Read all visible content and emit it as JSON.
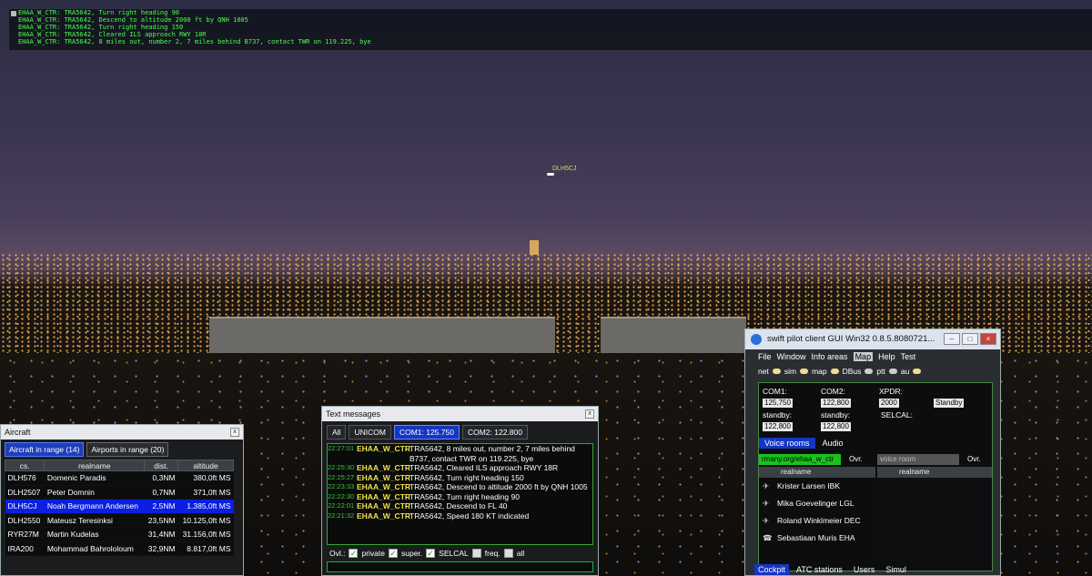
{
  "atc_messages": [
    "EHAA_W_CTR: TRA5642, Turn right heading 90",
    "EHAA_W_CTR: TRA5642, Descend to altitude 2000 ft by QNH 1005",
    "EHAA_W_CTR: TRA5642, Turn right heading 150",
    "EHAA_W_CTR: TRA5642, Cleared ILS approach RWY 18R",
    "EHAA_W_CTR: TRA5642, 8 miles out, number 2, 7 miles behind B737, contact TWR on 119.225, bye"
  ],
  "scene_callsign": "DLH5CJ",
  "aircraft": {
    "title": "Aircraft",
    "tabs": [
      "Aircraft in range (14)",
      "Airports in range (20)"
    ],
    "columns": [
      "cs.",
      "realname",
      "dist.",
      "altitude"
    ],
    "rows": [
      [
        "DLH576",
        "Domenic Paradis",
        "0,3NM",
        "380,0ft MS"
      ],
      [
        "DLH2507",
        "Peter Domnin",
        "0,7NM",
        "371,0ft MS"
      ],
      [
        "DLH5CJ",
        "Noah Bergmann Andersen",
        "2,5NM",
        "1.385,0ft MS"
      ],
      [
        "DLH2550",
        "Mateusz Teresinksi",
        "23,5NM",
        "10.125,0ft MS"
      ],
      [
        "RYR27M",
        "Martin Kudelas",
        "31,4NM",
        "31.156,0ft MS"
      ],
      [
        "IRA200",
        "Mohammad Bahrololoum",
        "32,9NM",
        "8.817,0ft MS"
      ]
    ]
  },
  "text": {
    "title": "Text messages",
    "tabs": [
      "All",
      "UNICOM",
      "COM1: 125.750",
      "COM2: 122.800"
    ],
    "messages": [
      {
        "time": "22:27:01",
        "sender": "EHAA_W_CTR",
        "text": "TRA5642, 8 miles out, number 2, 7 miles behind B737, contact TWR on 119.225, bye"
      },
      {
        "time": "22:25:30",
        "sender": "EHAA_W_CTR",
        "text": "TRA5642, Cleared ILS approach RWY 18R"
      },
      {
        "time": "22:25:27",
        "sender": "EHAA_W_CTR",
        "text": "TRA5642, Turn right heading 150"
      },
      {
        "time": "22:23:33",
        "sender": "EHAA_W_CTR",
        "text": "TRA5642, Descend to altitude 2000 ft by QNH 1005"
      },
      {
        "time": "22:22:30",
        "sender": "EHAA_W_CTR",
        "text": "TRA5642, Turn right heading 90"
      },
      {
        "time": "22:22:01",
        "sender": "EHAA_W_CTR",
        "text": "TRA5642, Descend to FL 40"
      },
      {
        "time": "22:21:32",
        "sender": "EHAA_W_CTR",
        "text": "TRA5642, Speed 180 KT indicated"
      }
    ],
    "ovl_label": "Ovl.:",
    "options": [
      "private",
      "super.",
      "SELCAL",
      "freq.",
      "all"
    ]
  },
  "swift": {
    "title": "swift pilot client GUI Win32 0.8.5.8080721...",
    "menu": [
      "File",
      "Window",
      "Info areas",
      "Map",
      "Help",
      "Test"
    ],
    "status": [
      "net",
      "sim",
      "map",
      "DBus",
      "ptt",
      "au"
    ],
    "com1_label": "COM1:",
    "com1": "125,750",
    "com2_label": "COM2:",
    "com2": "122,800",
    "xpdr_label": "XPDR:",
    "xpdr": "2000",
    "xpdr_mode": "Standby",
    "standby_label": "standby:",
    "standby1": "122,800",
    "standby2": "122,800",
    "selcal_label": "SELCAL:",
    "voice_tab": "Voice rooms",
    "audio_tab": "Audio",
    "voice_room1": "rmany.org/ehaa_w_ctr",
    "ovr": "Ovr.",
    "voice_room2": "voice room",
    "col_realname": "realname",
    "voice_users": [
      "Krister Larsen",
      "Mika Goevelinger",
      "Roland Winklmeier",
      "Sebastiaan Muris"
    ],
    "voice_codes": [
      "IBK",
      "LGL",
      "DEC",
      "EHA"
    ],
    "bottom_tabs": [
      "Cockpit",
      "ATC stations",
      "Users",
      "Simul"
    ]
  }
}
